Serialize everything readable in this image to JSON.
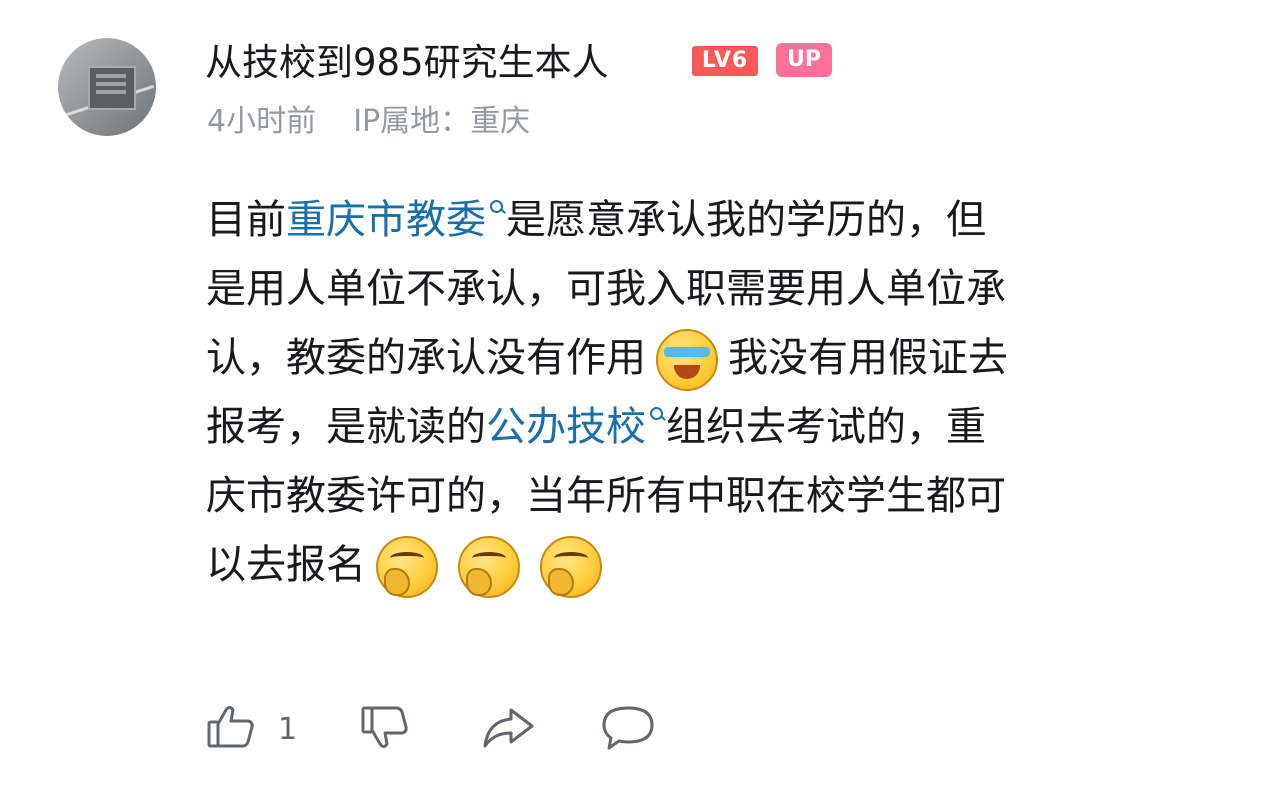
{
  "comment": {
    "username": "从技校到985研究生本人",
    "level_badge": "LV6",
    "up_badge": "UP",
    "time": "4小时前",
    "ip_location": "IP属地：重庆",
    "lines": [
      {
        "pre": "目前",
        "kw": "重庆市教委",
        "post": "是愿意承认我的学历的，但"
      },
      {
        "text": "是用人单位不承认，可我入职需要用人单位承"
      },
      {
        "pre": "认，教委的承认没有作用",
        "emoji": "cry-laugh-emoji",
        "post": "我没有用假证去"
      },
      {
        "pre": "报考，是就读的",
        "kw": "公办技校",
        "post": "组织去考试的，重"
      },
      {
        "text": "庆市教委许可的，当年所有中职在校学生都可"
      },
      {
        "pre": "以去报名"
      }
    ],
    "trailing_emojis": [
      "laugh-emoji",
      "laugh-emoji",
      "laugh-emoji"
    ],
    "like_count": "1"
  },
  "colors": {
    "keyword": "#1a6fa8",
    "level_badge": "#fa5a57",
    "up_badge": "#fb7299",
    "meta_text": "#9499a0"
  }
}
